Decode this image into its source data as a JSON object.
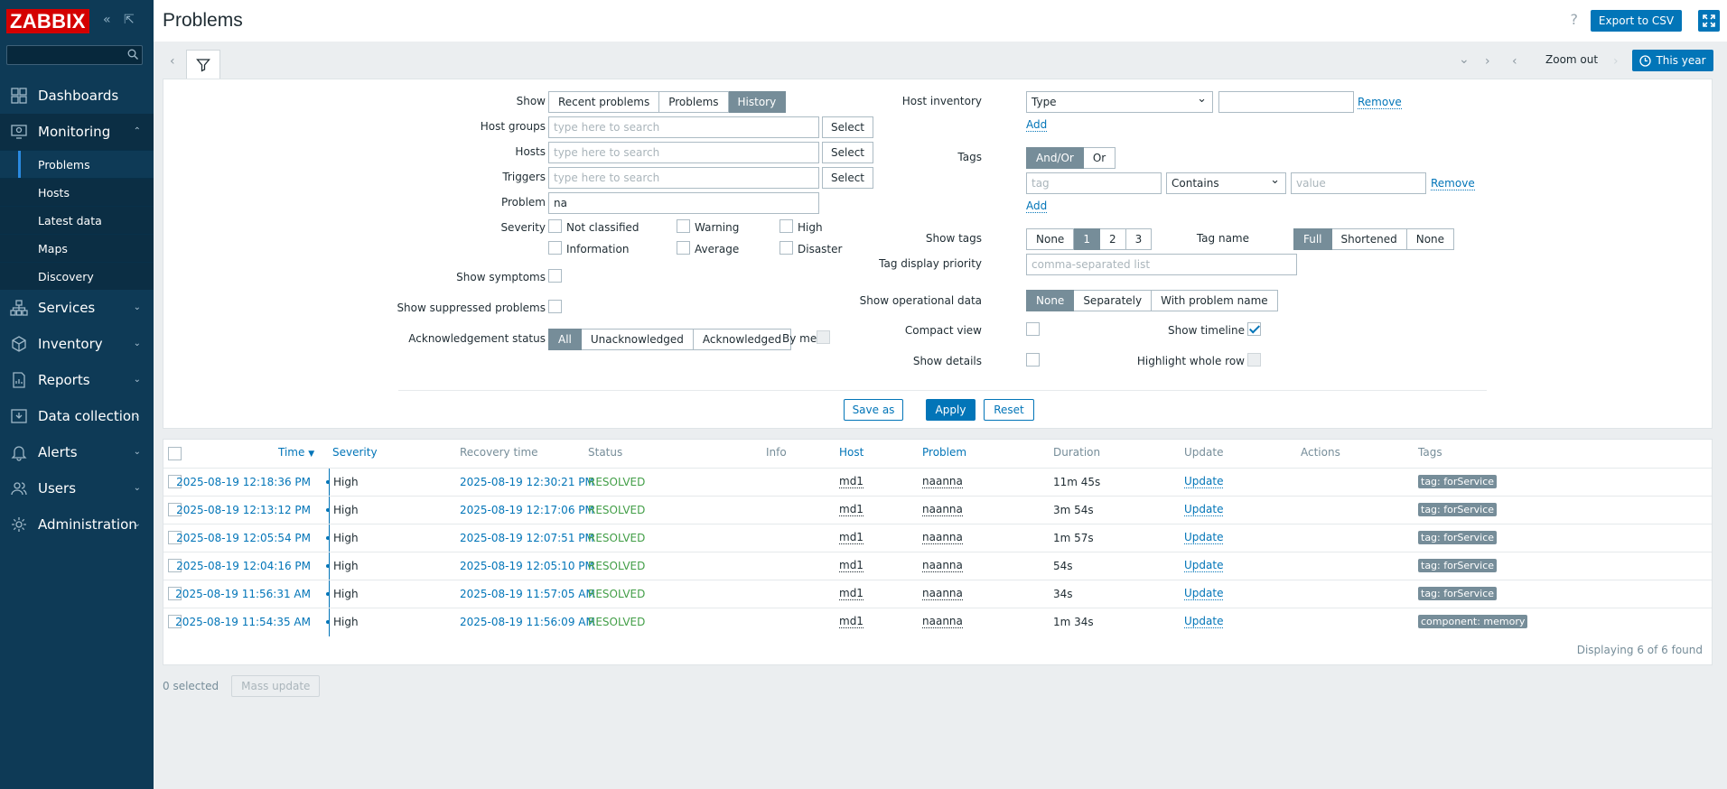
{
  "sidebar": {
    "logo": "ZABBIX",
    "items": [
      {
        "label": "Dashboards"
      },
      {
        "label": "Monitoring"
      },
      {
        "label": "Services"
      },
      {
        "label": "Inventory"
      },
      {
        "label": "Reports"
      },
      {
        "label": "Data collection"
      },
      {
        "label": "Alerts"
      },
      {
        "label": "Users"
      },
      {
        "label": "Administration"
      }
    ],
    "monitoring_sub": [
      "Problems",
      "Hosts",
      "Latest data",
      "Maps",
      "Discovery"
    ]
  },
  "header": {
    "title": "Problems",
    "help": "?",
    "export_label": "Export to CSV"
  },
  "timebar": {
    "zoom_out": "Zoom out",
    "this_year": "This year"
  },
  "filter": {
    "show_label": "Show",
    "show_options": [
      "Recent problems",
      "Problems",
      "History"
    ],
    "host_groups_label": "Host groups",
    "hosts_label": "Hosts",
    "triggers_label": "Triggers",
    "placeholder": "type here to search",
    "select_label": "Select",
    "problem_label": "Problem",
    "problem_value": "na",
    "severity_label": "Severity",
    "severities": [
      "Not classified",
      "Warning",
      "High",
      "Information",
      "Average",
      "Disaster"
    ],
    "show_symptoms_label": "Show symptoms",
    "show_suppressed_label": "Show suppressed problems",
    "ack_label": "Acknowledgement status",
    "ack_options": [
      "All",
      "Unacknowledged",
      "Acknowledged"
    ],
    "by_me_label": "By me",
    "host_inventory_label": "Host inventory",
    "inventory_type": "Type",
    "remove_label": "Remove",
    "add_label": "Add",
    "tags_label": "Tags",
    "tags_options": [
      "And/Or",
      "Or"
    ],
    "tag_placeholder": "tag",
    "tag_operator": "Contains",
    "value_placeholder": "value",
    "show_tags_label": "Show tags",
    "show_tags_options": [
      "None",
      "1",
      "2",
      "3"
    ],
    "tag_name_label": "Tag name",
    "tag_name_options": [
      "Full",
      "Shortened",
      "None"
    ],
    "tag_priority_label": "Tag display priority",
    "tag_priority_placeholder": "comma-separated list",
    "opdata_label": "Show operational data",
    "opdata_options": [
      "None",
      "Separately",
      "With problem name"
    ],
    "compact_label": "Compact view",
    "timeline_label": "Show timeline",
    "details_label": "Show details",
    "highlight_label": "Highlight whole row",
    "save_as": "Save as",
    "apply": "Apply",
    "reset": "Reset"
  },
  "table": {
    "headers": [
      "Time",
      "Severity",
      "Recovery time",
      "Status",
      "Info",
      "Host",
      "Problem",
      "Duration",
      "Update",
      "Actions",
      "Tags"
    ],
    "rows": [
      {
        "time": "2025-08-19 12:18:36 PM",
        "severity": "High",
        "recovery": "2025-08-19 12:30:21 PM",
        "status": "RESOLVED",
        "host": "md1",
        "problem": "naanna",
        "duration": "11m 45s",
        "update": "Update",
        "tag": "tag: forService"
      },
      {
        "time": "2025-08-19 12:13:12 PM",
        "severity": "High",
        "recovery": "2025-08-19 12:17:06 PM",
        "status": "RESOLVED",
        "host": "md1",
        "problem": "naanna",
        "duration": "3m 54s",
        "update": "Update",
        "tag": "tag: forService"
      },
      {
        "time": "2025-08-19 12:05:54 PM",
        "severity": "High",
        "recovery": "2025-08-19 12:07:51 PM",
        "status": "RESOLVED",
        "host": "md1",
        "problem": "naanna",
        "duration": "1m 57s",
        "update": "Update",
        "tag": "tag: forService"
      },
      {
        "time": "2025-08-19 12:04:16 PM",
        "severity": "High",
        "recovery": "2025-08-19 12:05:10 PM",
        "status": "RESOLVED",
        "host": "md1",
        "problem": "naanna",
        "duration": "54s",
        "update": "Update",
        "tag": "tag: forService"
      },
      {
        "time": "2025-08-19 11:56:31 AM",
        "severity": "High",
        "recovery": "2025-08-19 11:57:05 AM",
        "status": "RESOLVED",
        "host": "md1",
        "problem": "naanna",
        "duration": "34s",
        "update": "Update",
        "tag": "tag: forService"
      },
      {
        "time": "2025-08-19 11:54:35 AM",
        "severity": "High",
        "recovery": "2025-08-19 11:56:09 AM",
        "status": "RESOLVED",
        "host": "md1",
        "problem": "naanna",
        "duration": "1m 34s",
        "update": "Update",
        "tag": "component: memory"
      }
    ],
    "footer": "Displaying 6 of 6 found"
  },
  "bottom": {
    "selected": "0 selected",
    "mass_update": "Mass update"
  },
  "colors": {
    "sidebar": "#0e3a56",
    "accent": "#0275b8",
    "resolved": "#429e47",
    "tag": "#768d99"
  }
}
